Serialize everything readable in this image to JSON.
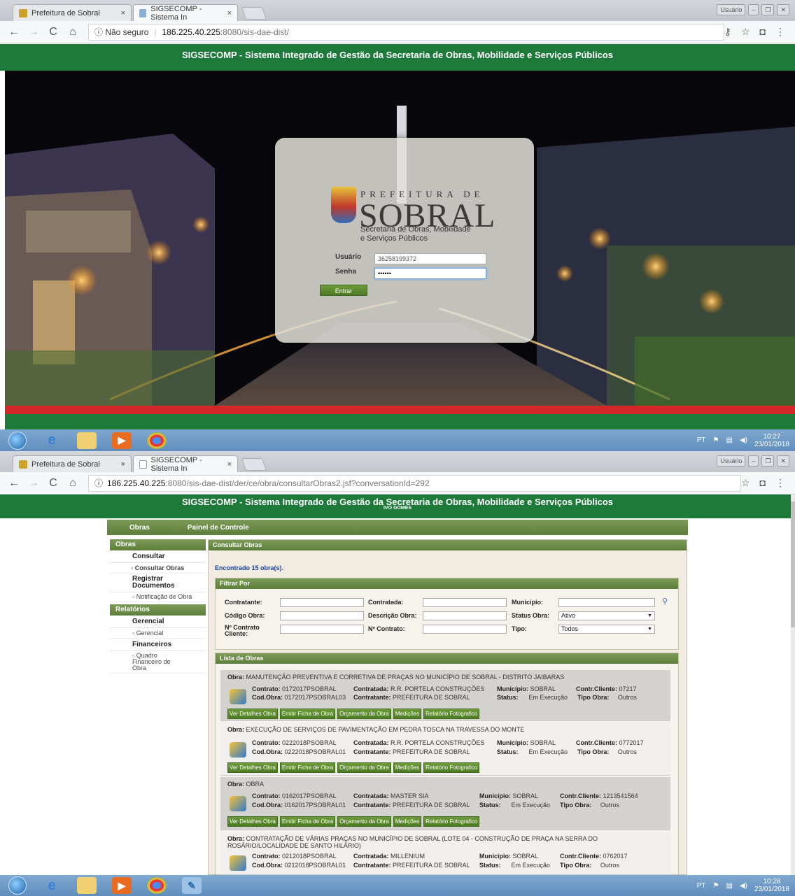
{
  "screen1": {
    "tabs": [
      {
        "label": "Prefeitura de Sobral",
        "close": "×"
      },
      {
        "label": "SIGSECOMP - Sistema In",
        "close": "×"
      }
    ],
    "window_controls": {
      "user": "Usuário",
      "min": "–",
      "max": "❐",
      "close": "✕"
    },
    "address": {
      "security": "ⓘ Não seguro",
      "host": "186.225.40.225",
      "path": ":8080/sis-dae-dist/"
    },
    "banner_title": "SIGSECOMP - Sistema Integrado de Gestão da Secretaria de Obras, Mobilidade e Serviços Públicos",
    "login": {
      "logo_top": "PREFEITURA DE",
      "logo_main": "SOBRAL",
      "logo_sub1": "Secretaria de Obras, Mobilidade",
      "logo_sub2": "e Serviços Públicos",
      "user_label": "Usuário",
      "user_value": "36258199372",
      "pass_label": "Senha",
      "pass_value": "••••••",
      "submit": "Entrar"
    },
    "taskbar": {
      "lang": "PT",
      "time": "10:27",
      "date": "23/01/2018"
    }
  },
  "screen2": {
    "tabs": [
      {
        "label": "Prefeitura de Sobral",
        "close": "×"
      },
      {
        "label": "SIGSECOMP - Sistema In",
        "close": "×"
      }
    ],
    "window_controls": {
      "user": "Usuário",
      "min": "–",
      "max": "❐",
      "close": "✕"
    },
    "address": {
      "security": "ⓘ",
      "host": "186.225.40.225",
      "path": ":8080/sis-dae-dist/der/ce/obra/consultarObras2.jsf?conversationId=292"
    },
    "banner_title": "SIGSECOMP - Sistema Integrado de Gestão da Secretaria de Obras, Mobilidade e Serviços Públicos",
    "banner_user": "IVO GOMES",
    "menu": {
      "obras": "Obras",
      "painel": "Painel de Controle"
    },
    "sidebar": {
      "obras_head": "Obras",
      "consultar": "Consultar",
      "consultar_obras": "Consultar Obras",
      "registrar": "Registrar Documentos",
      "notificacao": "Notificação de Obra",
      "relatorios_head": "Relatórios",
      "gerencial": "Gerencial",
      "gerencial_sub": "Gerencial",
      "financeiros": "Financeiros",
      "quadro": "Quadro Financeiro de Obra"
    },
    "main": {
      "title": "Consultar Obras",
      "found": "Encontrado 15 obra(s).",
      "filter_head": "Filtrar Por",
      "contratante": "Contratante:",
      "contratada": "Contratada:",
      "municipio": "Município:",
      "codigo": "Código Obra:",
      "descricao": "Descrição Obra:",
      "status": "Status Obra:",
      "status_value": "Ativo",
      "ncontrato_cli": "Nº Contrato Cliente:",
      "ncontrato": "Nº Contrato:",
      "tipo": "Tipo:",
      "tipo_value": "Todos",
      "list_head": "Lista de Obras"
    },
    "labels": {
      "obra": "Obra:",
      "contrato": "Contrato:",
      "codobra": "Cod.Obra:",
      "contratada": "Contratada:",
      "contratante": "Contratante:",
      "municipio": "Município:",
      "status": "Status:",
      "contr_cliente": "Contr.Cliente:",
      "tipo_obra": "Tipo Obra:"
    },
    "buttons": [
      "Ver Detalhes Obra",
      "Emitir Ficha de Obra",
      "Orçamento da Obra",
      "Medições",
      "Relatório Fotografico"
    ],
    "obras": [
      {
        "titulo": "MANUTENÇÃO PREVENTIVA E CORRETIVA DE PRAÇAS NO MUNICÍPIO DE SOBRAL - DISTRITO JAIBARAS",
        "contrato": "0172017PSOBRAL",
        "codobra": "0172017PSOBRAL03",
        "contratada": "R.R. PORTELA CONSTRUÇÕES",
        "contratante": "PREFEITURA DE SOBRAL",
        "municipio": "SOBRAL",
        "status": "Em Execução",
        "cliente": "07217",
        "tipo": "Outros"
      },
      {
        "titulo": "EXECUÇÃO DE SERVIÇOS DE PAVIMENTAÇÃO EM PEDRA TOSCA NA TRAVESSA DO MONTE",
        "contrato": "0222018PSOBRAL",
        "codobra": "0222018PSOBRAL01",
        "contratada": "R.R. PORTELA CONSTRUÇÕES",
        "contratante": "PREFEITURA DE SOBRAL",
        "municipio": "SOBRAL",
        "status": "Em Execução",
        "cliente": "0772017",
        "tipo": "Outros"
      },
      {
        "titulo": "OBRA",
        "contrato": "0162017PSOBRAL",
        "codobra": "0162017PSOBRAL01",
        "contratada": "MASTER SIA",
        "contratante": "PREFEITURA DE SOBRAL",
        "municipio": "SOBRAL",
        "status": "Em Execução",
        "cliente": "1213541564",
        "tipo": "Outros"
      },
      {
        "titulo": "CONTRATAÇÃO DE VÁRIAS PRAÇAS NO MUNICÍPIO DE SOBRAL (LOTE 04 - CONSTRUÇÃO DE PRAÇA NA SERRA DO ROSÁRIO/LOCALIDADE DE SANTO HILÁRIO)",
        "contrato": "0212018PSOBRAL",
        "codobra": "0212018PSOBRAL01",
        "contratada": "MILLENIUM",
        "contratante": "PREFEITURA DE SOBRAL",
        "municipio": "SOBRAL",
        "status": "Em Execução",
        "cliente": "0762017",
        "tipo": "Outros"
      }
    ],
    "taskbar": {
      "lang": "PT",
      "time": "10:28",
      "date": "23/01/2018"
    }
  }
}
